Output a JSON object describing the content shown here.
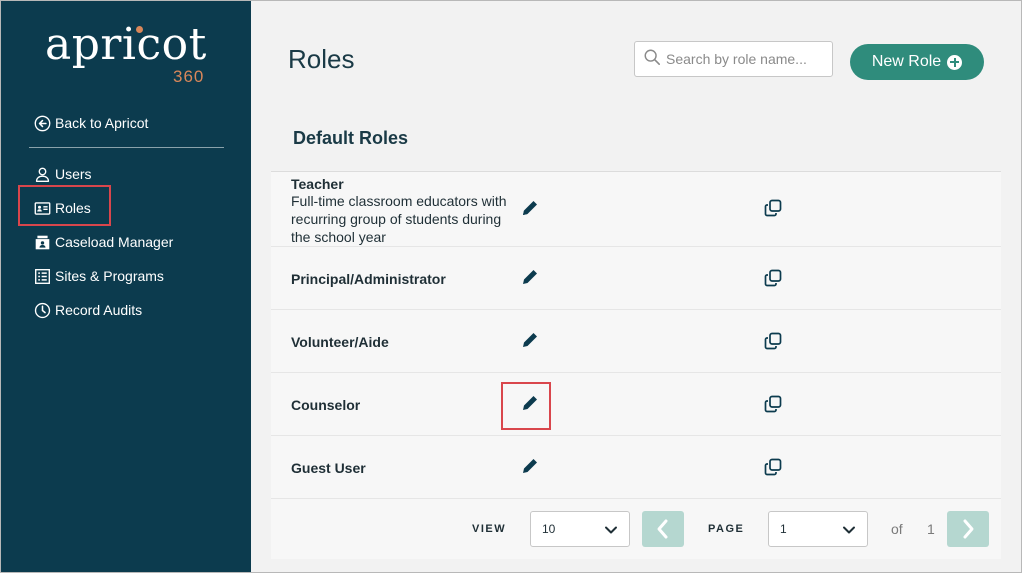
{
  "brand": {
    "logo_word": "apricot",
    "logo_number": "360",
    "accent": "#d9875a",
    "sidebar_bg": "#0c3b4e"
  },
  "sidebar": {
    "back_label": "Back to Apricot",
    "items": [
      {
        "label": "Users",
        "icon": "user-icon"
      },
      {
        "label": "Roles",
        "icon": "id-card-icon"
      },
      {
        "label": "Caseload Manager",
        "icon": "caseload-icon"
      },
      {
        "label": "Sites & Programs",
        "icon": "list-icon"
      },
      {
        "label": "Record Audits",
        "icon": "clock-icon"
      }
    ]
  },
  "header": {
    "title": "Roles",
    "search_placeholder": "Search by role name...",
    "new_role_label": "New Role"
  },
  "section": {
    "title": "Default Roles"
  },
  "roles": [
    {
      "name": "Teacher",
      "description": "Full-time classroom educators with recurring group of students during the school year"
    },
    {
      "name": "Principal/Administrator",
      "description": ""
    },
    {
      "name": "Volunteer/Aide",
      "description": ""
    },
    {
      "name": "Counselor",
      "description": ""
    },
    {
      "name": "Guest User",
      "description": ""
    }
  ],
  "pagination": {
    "view_label": "VIEW",
    "view_value": "10",
    "page_label": "PAGE",
    "page_value": "1",
    "of_label": "of",
    "total_pages": "1"
  },
  "colors": {
    "button": "#2f8c7c",
    "highlight": "#d9464c",
    "pager_button": "#b5d7d0"
  }
}
